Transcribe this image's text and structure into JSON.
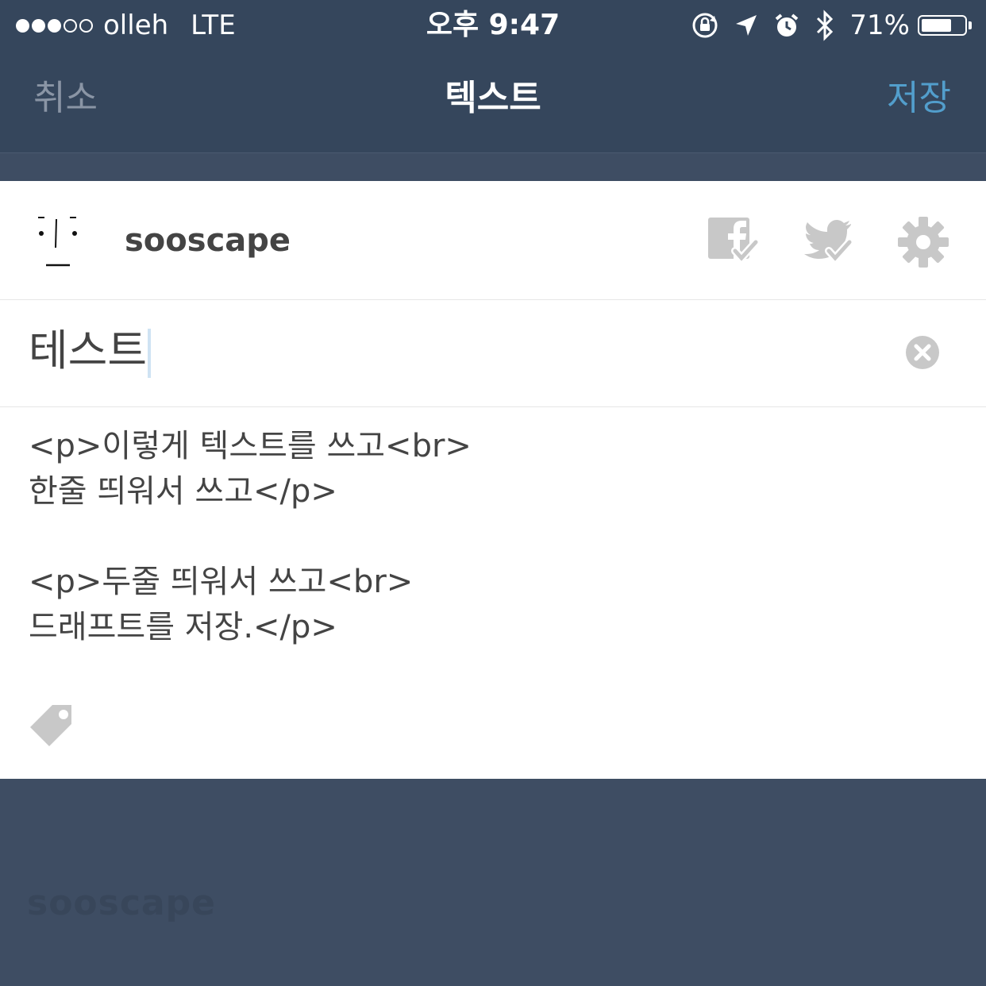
{
  "status_bar": {
    "carrier": "olleh",
    "network": "LTE",
    "time": "오후 9:47",
    "battery_percent": "71%",
    "battery_level": 0.71,
    "signal_filled": 3,
    "signal_total": 5
  },
  "nav": {
    "cancel_label": "취소",
    "title": "텍스트",
    "save_label": "저장"
  },
  "blog": {
    "name": "sooscape"
  },
  "post": {
    "title_value": "테스트",
    "body_lines": [
      "<p>이렇게 텍스트를 쓰고<br>",
      "한줄 띄워서 쓰고</p>",
      "",
      "<p>두줄 띄워서 쓰고<br>",
      "드래프트를 저장.</p>"
    ]
  },
  "footer": {
    "brand": "sooscape"
  },
  "colors": {
    "nav_bg": "#35465c",
    "page_bg": "#3e4d63",
    "accent": "#529ecc",
    "text": "#444444",
    "icon_gray": "#c8c8c8"
  }
}
